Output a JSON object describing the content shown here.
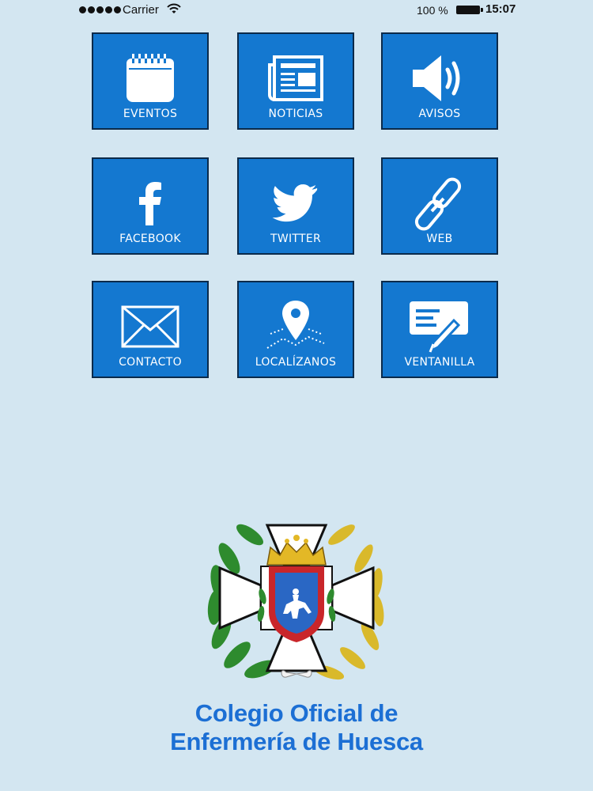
{
  "status_bar": {
    "carrier": "Carrier",
    "battery": "100 %",
    "time": "15:07"
  },
  "tiles": [
    {
      "label": "EVENTOS",
      "icon": "calendar-icon"
    },
    {
      "label": "NOTICIAS",
      "icon": "newspaper-icon"
    },
    {
      "label": "AVISOS",
      "icon": "speaker-icon"
    },
    {
      "label": "FACEBOOK",
      "icon": "facebook-icon"
    },
    {
      "label": "TWITTER",
      "icon": "twitter-bird-icon"
    },
    {
      "label": "WEB",
      "icon": "chain-link-icon"
    },
    {
      "label": "CONTACTO",
      "icon": "envelope-icon"
    },
    {
      "label": "LOCALÍZANOS",
      "icon": "map-pin-icon"
    },
    {
      "label": "VENTANILLA",
      "icon": "form-pen-icon"
    }
  ],
  "organization": {
    "name_line1": "Colegio Oficial de",
    "name_line2": "Enfermería de Huesca"
  },
  "colors": {
    "background": "#d3e6f1",
    "tile": "#1478d0",
    "tile_border": "#0b2a4a",
    "brand_text": "#1c6fd4"
  }
}
